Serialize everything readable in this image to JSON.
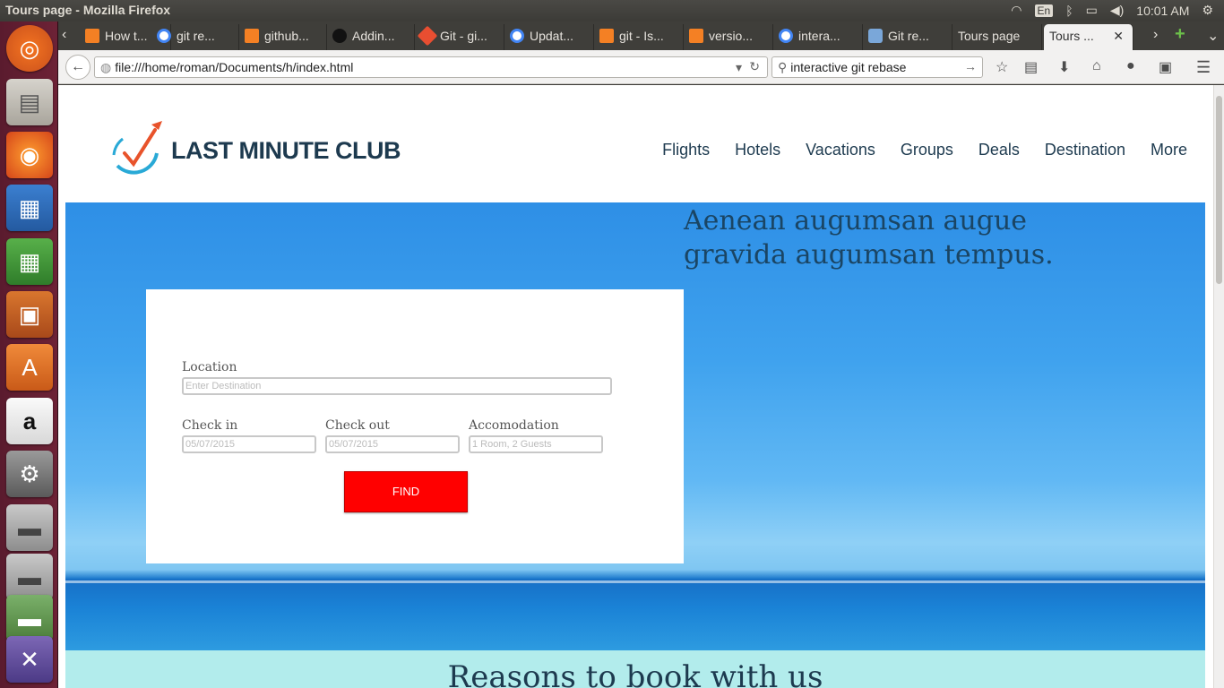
{
  "os": {
    "window_title": "Tours page - Mozilla Firefox",
    "lang": "En",
    "time": "10:01 AM"
  },
  "tabs": [
    {
      "label": "How t...",
      "icon": "stackoverflow-icon"
    },
    {
      "label": "git re...",
      "icon": "google-icon"
    },
    {
      "label": "github...",
      "icon": "stackoverflow-icon"
    },
    {
      "label": "Addin...",
      "icon": "github-icon"
    },
    {
      "label": "Git - gi...",
      "icon": "git-icon"
    },
    {
      "label": "Updat...",
      "icon": "google-icon"
    },
    {
      "label": "git - Is...",
      "icon": "stackoverflow-icon"
    },
    {
      "label": "versio...",
      "icon": "stackoverflow-icon"
    },
    {
      "label": "intera...",
      "icon": "google-icon"
    },
    {
      "label": "Git re...",
      "icon": "database-icon"
    },
    {
      "label": "Tours page",
      "icon": ""
    },
    {
      "label": "Tours ...",
      "icon": "",
      "active": true
    }
  ],
  "urlbar": {
    "url": "file:///home/roman/Documents/h/index.html",
    "search": "interactive git rebase"
  },
  "site": {
    "brand": "LAST MINUTE CLUB",
    "nav": [
      "Flights",
      "Hotels",
      "Vacations",
      "Groups",
      "Deals",
      "Destination",
      "More"
    ],
    "tagline": "Aenean augumsan augue gravida augumsan tempus.",
    "form": {
      "location_label": "Location",
      "location_placeholder": "Enter Destination",
      "checkin_label": "Check in",
      "checkin_placeholder": "05/07/2015",
      "checkout_label": "Check out",
      "checkout_placeholder": "05/07/2015",
      "accomodation_label": "Accomodation",
      "accomodation_placeholder": "1 Room, 2 Guests",
      "find_label": "FIND"
    },
    "reasons_heading": "Reasons to book with us"
  },
  "colors": {
    "brand_navy": "#1d3a4f",
    "find_red": "#ff0000",
    "logo_orange": "#e8532b",
    "logo_teal": "#29a9d6"
  }
}
